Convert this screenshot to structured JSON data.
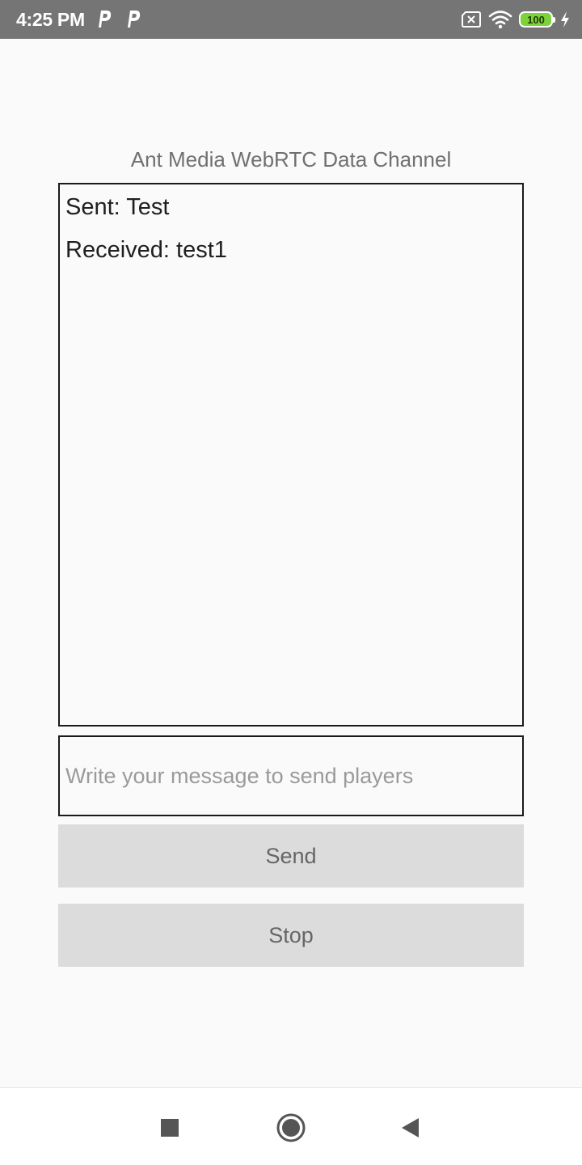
{
  "status_bar": {
    "time": "4:25 PM",
    "notification_icons": [
      "parking-p-icon",
      "parking-p-icon"
    ],
    "battery_level": "100",
    "icons": [
      "sim-off-icon",
      "wifi-icon",
      "battery-icon",
      "charging-icon"
    ],
    "background_color": "#757575",
    "battery_color": "#7dd13b"
  },
  "app": {
    "title": "Ant Media WebRTC Data Channel"
  },
  "message_log": {
    "lines": [
      "Sent: Test",
      "Received: test1"
    ]
  },
  "message_input": {
    "value": "",
    "placeholder": "Write your message to send players"
  },
  "buttons": {
    "send_label": "Send",
    "stop_label": "Stop",
    "background_color": "#dcdcdc"
  },
  "nav_bar": {
    "icons": [
      "recent-apps-square-icon",
      "home-circle-icon",
      "back-triangle-icon"
    ]
  }
}
